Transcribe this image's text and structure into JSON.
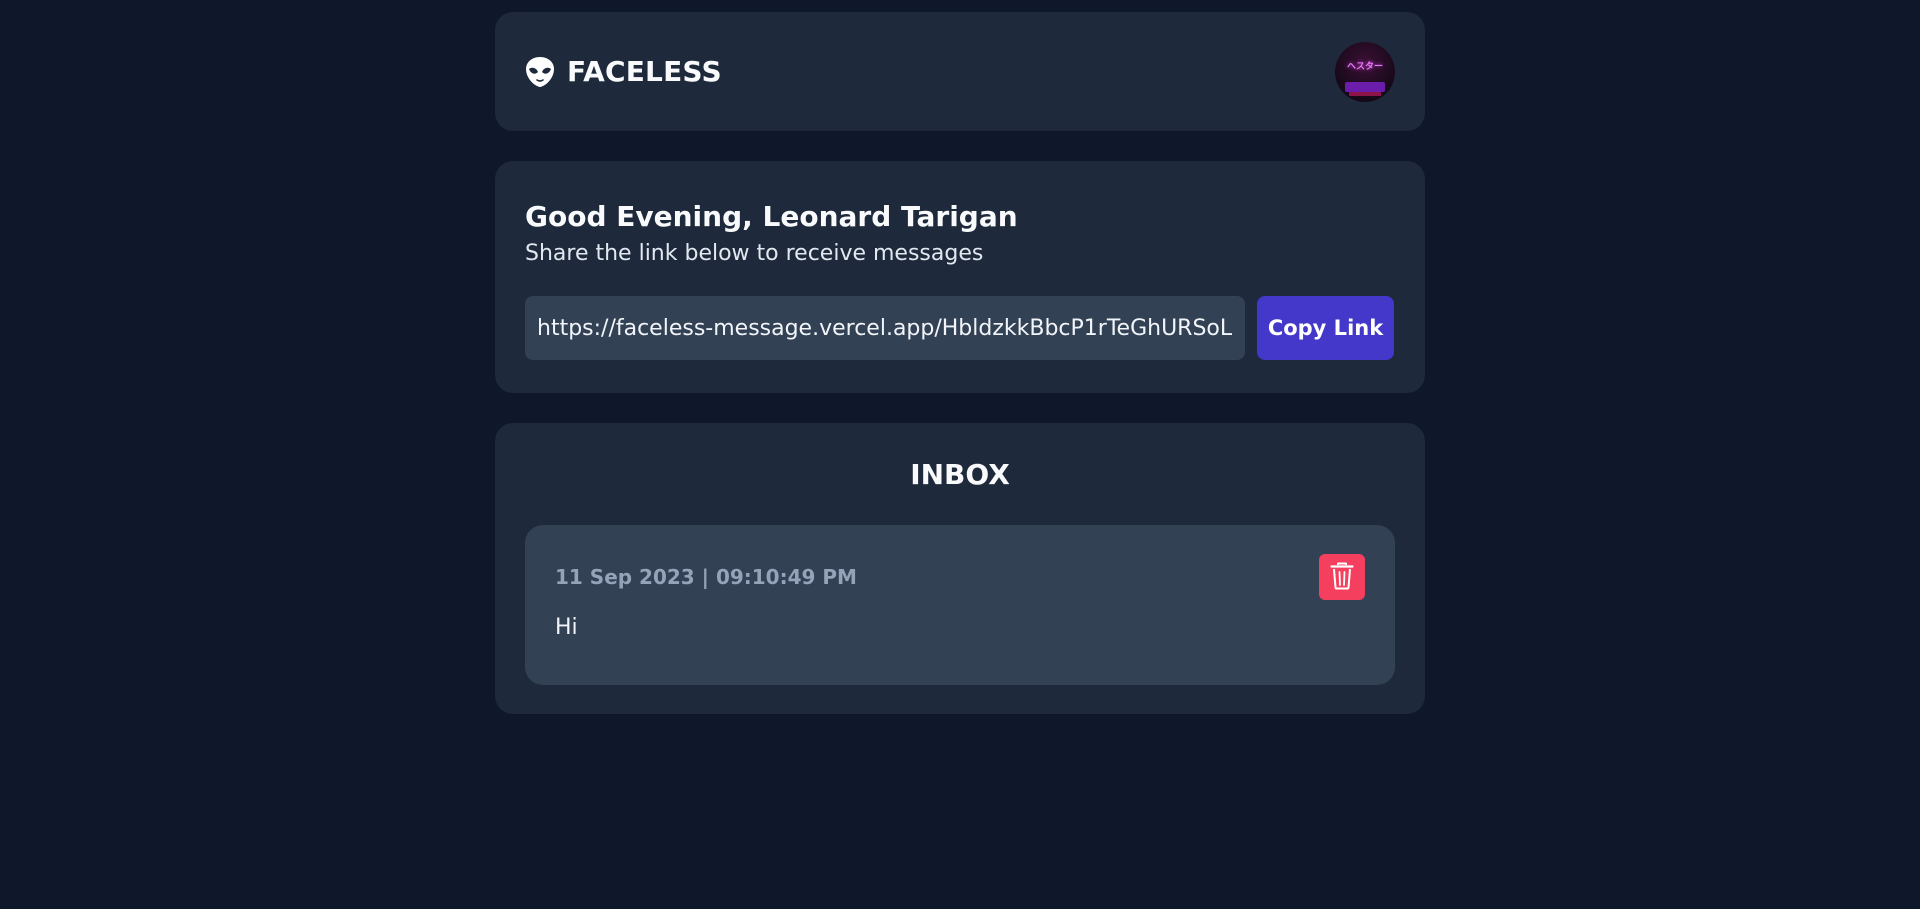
{
  "header": {
    "brand_name": "FACELESS",
    "avatar_sign": "ヘスター"
  },
  "greeting": {
    "title": "Good Evening, Leonard Tarigan",
    "subtitle": "Share the link below to receive messages",
    "link_value": "https://faceless-message.vercel.app/HbldzkkBbcP1rTeGhURSoL",
    "copy_label": "Copy Link"
  },
  "inbox": {
    "title": "INBOX",
    "messages": [
      {
        "time": "11 Sep 2023 | 09:10:49 PM",
        "body": "Hi"
      }
    ]
  },
  "colors": {
    "background": "#0f172a",
    "card": "#1e293b",
    "message_card": "#334155",
    "accent": "#4338ca",
    "danger": "#f43f5e",
    "muted_text": "#94a3b8"
  },
  "icons": {
    "brand": "alien-face-icon",
    "delete": "trash-icon"
  }
}
